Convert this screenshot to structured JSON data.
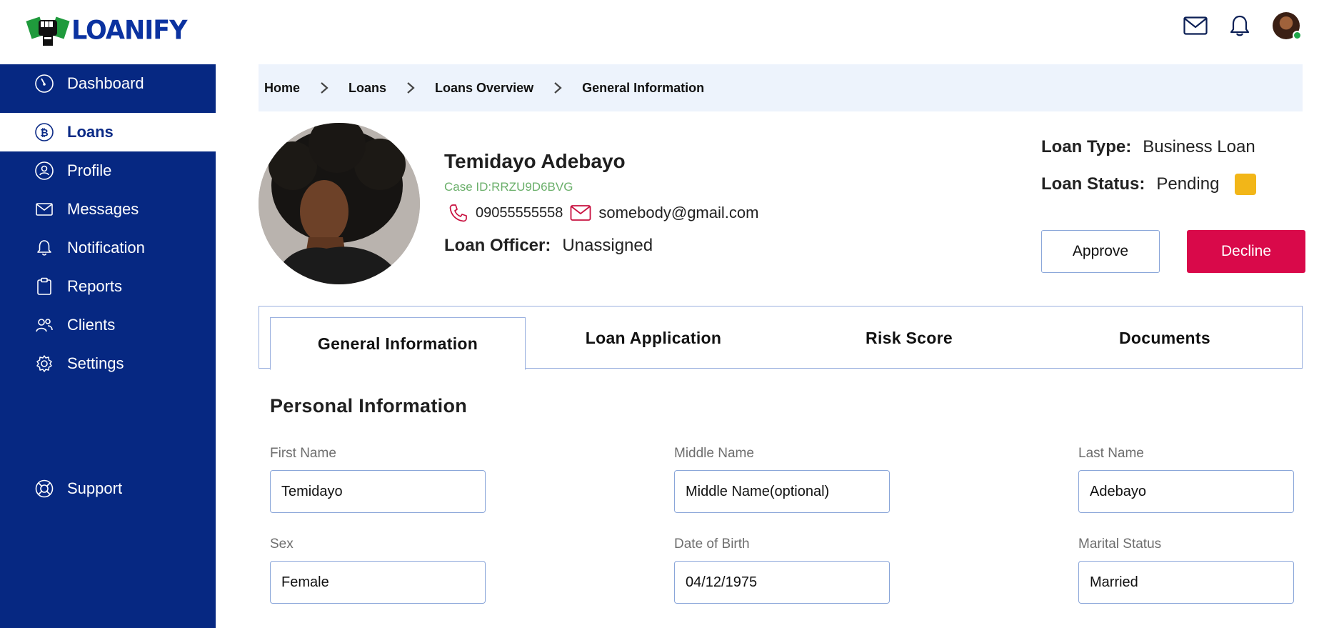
{
  "app": {
    "brand": "LOANIFY"
  },
  "sidebar": {
    "items": [
      {
        "label": "Dashboard",
        "icon": "gauge-icon"
      },
      {
        "label": "Loans",
        "icon": "bitcoin-icon"
      },
      {
        "label": "Profile",
        "icon": "user-circle-icon"
      },
      {
        "label": "Messages",
        "icon": "envelope-icon"
      },
      {
        "label": "Notification",
        "icon": "bell-icon"
      },
      {
        "label": "Reports",
        "icon": "clipboard-icon"
      },
      {
        "label": "Clients",
        "icon": "users-icon"
      },
      {
        "label": "Settings",
        "icon": "gear-icon"
      }
    ],
    "support": {
      "label": "Support",
      "icon": "lifebuoy-icon"
    },
    "active": "Loans"
  },
  "breadcrumb": [
    "Home",
    "Loans",
    "Loans Overview",
    "General Information"
  ],
  "profile": {
    "name": "Temidayo Adebayo",
    "case_id": "Case ID:RRZU9D6BVG",
    "phone": "09055555558",
    "email": "somebody@gmail.com",
    "officer_label": "Loan Officer:",
    "officer_value": "Unassigned"
  },
  "loan": {
    "type_label": "Loan Type:",
    "type_value": "Business Loan",
    "status_label": "Loan Status:",
    "status_value": "Pending",
    "status_color": "#f2b618"
  },
  "actions": {
    "approve": "Approve",
    "decline": "Decline"
  },
  "tabs": [
    "General Information",
    "Loan Application",
    "Risk Score",
    "Documents"
  ],
  "section": {
    "title": "Personal Information",
    "fields": [
      {
        "label": "First Name",
        "value": "Temidayo"
      },
      {
        "label": "Middle Name",
        "value": "Middle Name(optional)"
      },
      {
        "label": "Last Name",
        "value": "Adebayo"
      },
      {
        "label": "Sex",
        "value": "Female"
      },
      {
        "label": "Date of Birth",
        "value": "04/12/1975"
      },
      {
        "label": "Marital Status",
        "value": "Married"
      }
    ]
  },
  "colors": {
    "sidebar": "#062882",
    "brand": "#0b32a0",
    "decline": "#d9094a",
    "breadcrumb_bg": "#edf3fc"
  }
}
